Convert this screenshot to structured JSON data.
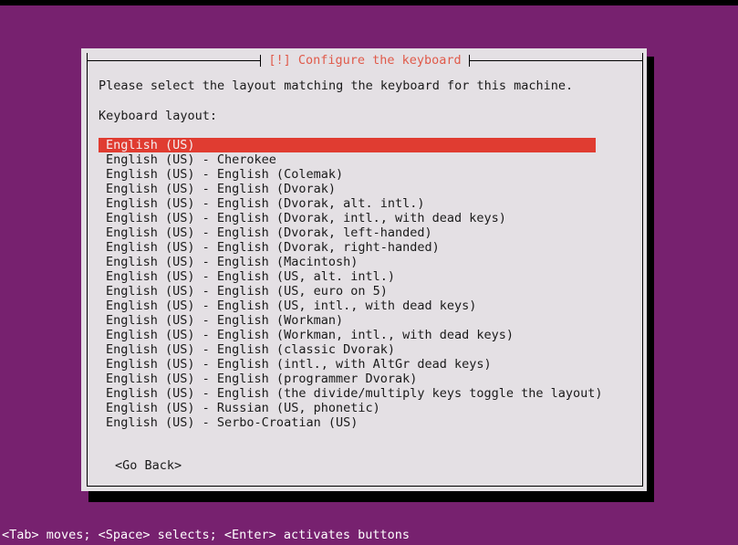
{
  "window": {
    "title": "[!] Configure the keyboard",
    "background_color": "#77216f",
    "dialog_background_color": "#e4e0e4",
    "title_color": "#e05a4a",
    "highlight_color": "#e03c31"
  },
  "dialog": {
    "prompt": "Please select the layout matching the keyboard for this machine.",
    "field_label": "Keyboard layout:",
    "selected_index": 0,
    "options": [
      "English (US)",
      "English (US) - Cherokee",
      "English (US) - English (Colemak)",
      "English (US) - English (Dvorak)",
      "English (US) - English (Dvorak, alt. intl.)",
      "English (US) - English (Dvorak, intl., with dead keys)",
      "English (US) - English (Dvorak, left-handed)",
      "English (US) - English (Dvorak, right-handed)",
      "English (US) - English (Macintosh)",
      "English (US) - English (US, alt. intl.)",
      "English (US) - English (US, euro on 5)",
      "English (US) - English (US, intl., with dead keys)",
      "English (US) - English (Workman)",
      "English (US) - English (Workman, intl., with dead keys)",
      "English (US) - English (classic Dvorak)",
      "English (US) - English (intl., with AltGr dead keys)",
      "English (US) - English (programmer Dvorak)",
      "English (US) - English (the divide/multiply keys toggle the layout)",
      "English (US) - Russian (US, phonetic)",
      "English (US) - Serbo-Croatian (US)"
    ],
    "buttons": [
      "<Go Back>"
    ]
  },
  "statusbar": {
    "hint": "<Tab> moves; <Space> selects; <Enter> activates buttons"
  }
}
